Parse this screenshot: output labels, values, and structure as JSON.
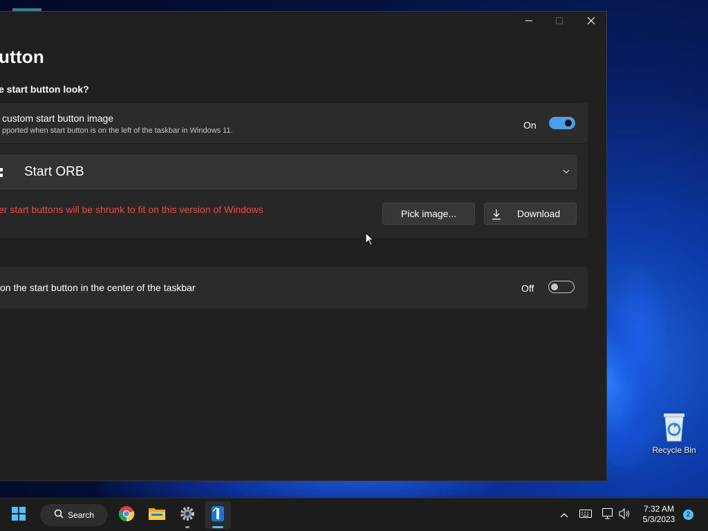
{
  "window": {
    "page_title": "utton",
    "section_question": "e start button look?",
    "controls": {
      "minimize": "—",
      "maximize": "☐",
      "close": "✕"
    }
  },
  "custom_image_setting": {
    "title": "custom start button image",
    "description": "pported when start button is on the left of the taskbar in Windows 11.",
    "state_label": "On",
    "enabled": true
  },
  "orb_select": {
    "selected": "Start ORB"
  },
  "warning": {
    "text": "er start buttons will be shrunk to fit on this version of Windows"
  },
  "buttons": {
    "pick_image": "Pick image...",
    "download": "Download"
  },
  "center_setting": {
    "title": "on the start button in the center of the taskbar",
    "state_label": "Off",
    "enabled": false
  },
  "desktop": {
    "recycle_bin_label": "Recycle Bin"
  },
  "taskbar": {
    "search_label": "Search",
    "apps": [
      "start-icon",
      "chrome-icon",
      "file-explorer-icon",
      "settings-icon",
      "start-app-icon"
    ],
    "time": "7:32 AM",
    "date": "5/3/2023",
    "notification_count": "2"
  },
  "colors": {
    "accent": "#4c9ee8",
    "warning": "#f04a3c",
    "window_bg": "#202020",
    "card_bg": "#2b2b2b"
  }
}
